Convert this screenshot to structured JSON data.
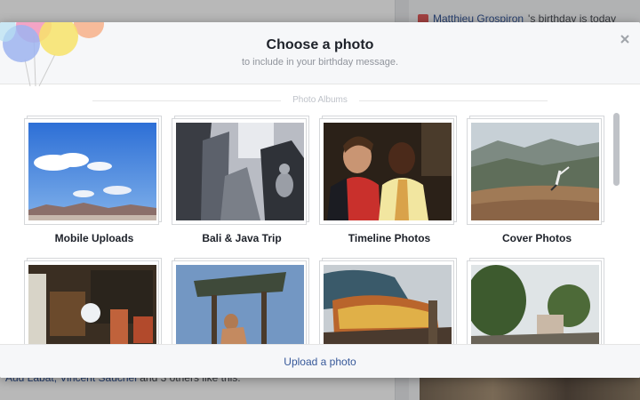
{
  "background": {
    "notification": {
      "name": "Matthieu Grospiron",
      "text": "'s birthday is today"
    },
    "likes_text": {
      "names": "Aud Labat, Vincent Saucnel",
      "rest": " and 3 others like this."
    }
  },
  "dialog": {
    "title": "Choose a photo",
    "subtitle": "to include in your birthday message.",
    "close_icon": "close-icon",
    "section_label": "Photo Albums",
    "albums": [
      {
        "name": "Mobile Uploads"
      },
      {
        "name": "Bali & Java Trip"
      },
      {
        "name": "Timeline Photos"
      },
      {
        "name": "Cover Photos"
      },
      {
        "name": ""
      },
      {
        "name": ""
      },
      {
        "name": ""
      },
      {
        "name": ""
      }
    ],
    "footer": {
      "upload_label": "Upload a photo"
    }
  },
  "colors": {
    "link": "#365899",
    "title": "#1d2129",
    "subtitle": "#90949c",
    "header_bg": "#f6f7f9"
  }
}
